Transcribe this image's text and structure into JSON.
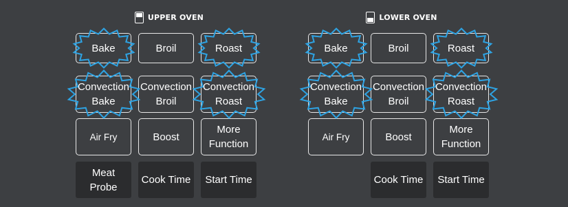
{
  "colors": {
    "background": "#3d3f42",
    "highlight": "#2ea3e3",
    "dark_button": "#2b2c2e"
  },
  "upper": {
    "title": "UPPER OVEN",
    "icon": "oven-upper-icon",
    "buttons": {
      "bake": "Bake",
      "broil": "Broil",
      "roast": "Roast",
      "conv_bake": "Convection\nBake",
      "conv_broil": "Convection\nBroil",
      "conv_roast": "Convection\nRoast",
      "air_fry": "Air Fry",
      "boost": "Boost",
      "more": "More\nFunction",
      "meat_probe": "Meat\nProbe",
      "cook_time": "Cook Time",
      "start_time": "Start Time"
    }
  },
  "lower": {
    "title": "LOWER OVEN",
    "icon": "oven-lower-icon",
    "buttons": {
      "bake": "Bake",
      "broil": "Broil",
      "roast": "Roast",
      "conv_bake": "Convection\nBake",
      "conv_broil": "Convection\nBroil",
      "conv_roast": "Convection\nRoast",
      "air_fry": "Air Fry",
      "boost": "Boost",
      "more": "More\nFunction",
      "cook_time": "Cook Time",
      "start_time": "Start Time"
    }
  }
}
